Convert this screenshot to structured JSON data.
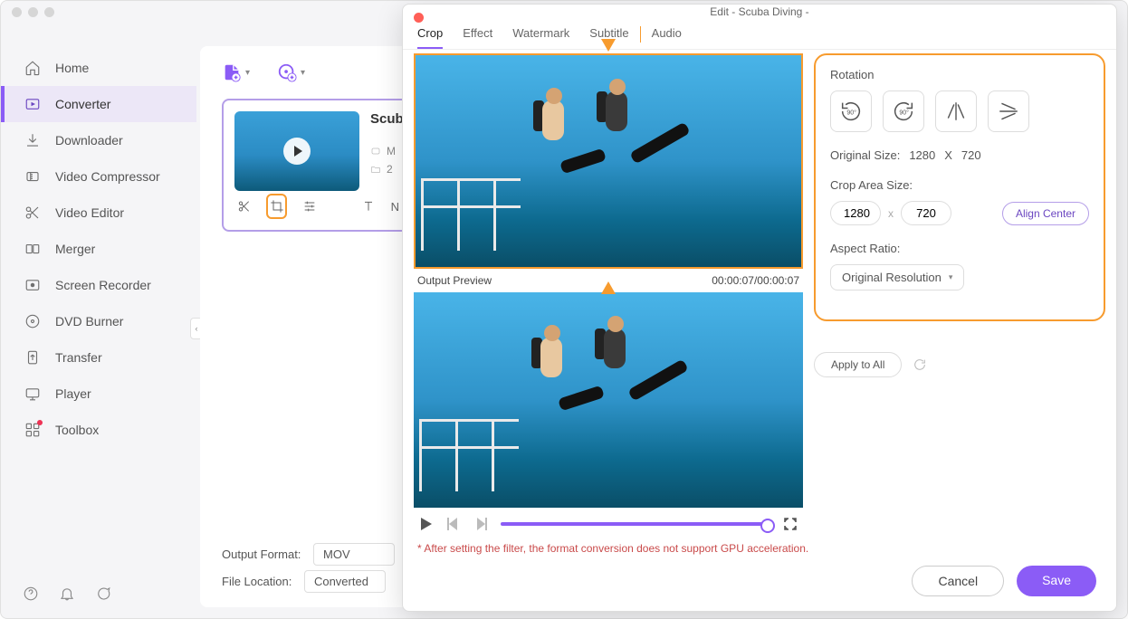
{
  "main": {
    "sidebar": {
      "items": [
        {
          "label": "Home"
        },
        {
          "label": "Converter"
        },
        {
          "label": "Downloader"
        },
        {
          "label": "Video Compressor"
        },
        {
          "label": "Video Editor"
        },
        {
          "label": "Merger"
        },
        {
          "label": "Screen Recorder"
        },
        {
          "label": "DVD Burner"
        },
        {
          "label": "Transfer"
        },
        {
          "label": "Player"
        },
        {
          "label": "Toolbox"
        }
      ]
    },
    "card": {
      "title": "Scub",
      "meta1": "M",
      "meta2": "2"
    },
    "output_format_label": "Output Format:",
    "output_format_value": "MOV",
    "file_location_label": "File Location:",
    "file_location_value": "Converted"
  },
  "modal": {
    "title": "Edit - Scuba Diving -",
    "tabs": [
      "Crop",
      "Effect",
      "Watermark",
      "Subtitle",
      "Audio"
    ],
    "preview_label": "Output Preview",
    "time": "00:00:07/00:00:07",
    "rotation_label": "Rotation",
    "rot_deg_ccw": "90°",
    "rot_deg_cw": "90°",
    "orig_size_label": "Original Size:",
    "orig_w": "1280",
    "orig_x": "X",
    "orig_h": "720",
    "crop_label": "Crop Area Size:",
    "crop_w": "1280",
    "crop_h": "720",
    "align_center": "Align Center",
    "aspect_label": "Aspect Ratio:",
    "aspect_value": "Original Resolution",
    "apply_all": "Apply to All",
    "warning": "* After setting the filter, the format conversion does not support GPU acceleration.",
    "cancel": "Cancel",
    "save": "Save"
  }
}
